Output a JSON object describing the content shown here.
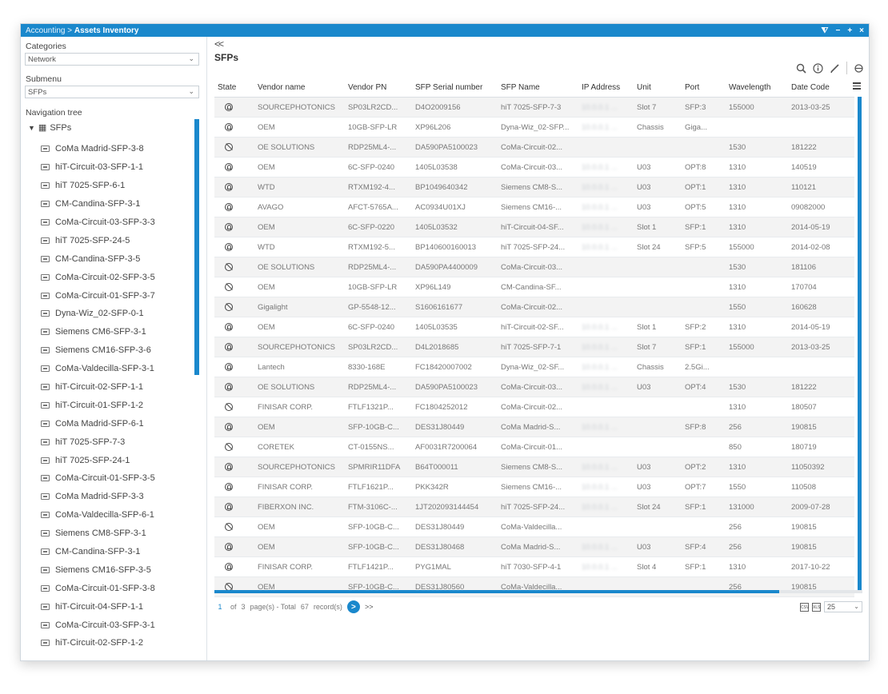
{
  "window": {
    "breadcrumb_parent": "Accounting >",
    "breadcrumb_current": "Assets Inventory",
    "controls": [
      "⧨",
      "−",
      "+",
      "×"
    ]
  },
  "sidebar": {
    "categories_label": "Categories",
    "categories_value": "Network",
    "submenu_label": "Submenu",
    "submenu_value": "SFPs",
    "nav_tree_label": "Navigation tree",
    "tree_root": "SFPs",
    "tree_items": [
      "CoMa Madrid-SFP-3-8",
      "hiT-Circuit-03-SFP-1-1",
      "hiT 7025-SFP-6-1",
      "CM-Candina-SFP-3-1",
      "CoMa-Circuit-03-SFP-3-3",
      "hiT 7025-SFP-24-5",
      "CM-Candina-SFP-3-5",
      "CoMa-Circuit-02-SFP-3-5",
      "CoMa-Circuit-01-SFP-3-7",
      "Dyna-Wiz_02-SFP-0-1",
      "Siemens CM6-SFP-3-1",
      "Siemens CM16-SFP-3-6",
      "CoMa-Valdecilla-SFP-3-1",
      "hiT-Circuit-02-SFP-1-1",
      "hiT-Circuit-01-SFP-1-2",
      "CoMa Madrid-SFP-6-1",
      "hiT 7025-SFP-7-3",
      "hiT 7025-SFP-24-1",
      "CoMa-Circuit-01-SFP-3-5",
      "CoMa Madrid-SFP-3-3",
      "CoMa-Valdecilla-SFP-6-1",
      "Siemens CM8-SFP-3-1",
      "CM-Candina-SFP-3-1",
      "Siemens CM16-SFP-3-5",
      "CoMa-Circuit-01-SFP-3-8",
      "hiT-Circuit-04-SFP-1-1",
      "CoMa-Circuit-03-SFP-3-1",
      "hiT-Circuit-02-SFP-1-2"
    ]
  },
  "main": {
    "collapse": "<<",
    "title": "SFPs",
    "columns": [
      "State",
      "Vendor name",
      "Vendor PN",
      "SFP Serial number",
      "SFP Name",
      "IP Address",
      "Unit",
      "Port",
      "Wavelength",
      "Date Code"
    ],
    "rows": [
      {
        "state": "on",
        "vendor": "SOURCEPHOTONICS",
        "pn": "SP03LR2CD...",
        "serial": "D4O2009156",
        "name": "hiT 7025-SFP-7-3",
        "ip": "10.0.0.1 ...",
        "unit": "Slot 7",
        "port": "SFP:3",
        "wl": "155000",
        "date": "2013-03-25"
      },
      {
        "state": "on",
        "vendor": "OEM",
        "pn": "10GB-SFP-LR",
        "serial": "XP96L206",
        "name": "Dyna-Wiz_02-SFP...",
        "ip": "10.0.0.1 ...",
        "unit": "Chassis",
        "port": "Giga...",
        "wl": "",
        "date": ""
      },
      {
        "state": "off",
        "vendor": "OE SOLUTIONS",
        "pn": "RDP25ML4-...",
        "serial": "DA590PA5100023",
        "name": "CoMa-Circuit-02...",
        "ip": "",
        "unit": "",
        "port": "",
        "wl": "1530",
        "date": "181222"
      },
      {
        "state": "on",
        "vendor": "OEM",
        "pn": "6C-SFP-0240",
        "serial": "1405L03538",
        "name": "CoMa-Circuit-03...",
        "ip": "10.0.0.1 ...",
        "unit": "U03",
        "port": "OPT:8",
        "wl": "1310",
        "date": "140519"
      },
      {
        "state": "on",
        "vendor": "WTD",
        "pn": "RTXM192-4...",
        "serial": "BP1049640342",
        "name": "Siemens CM8-S...",
        "ip": "10.0.0.1 ...",
        "unit": "U03",
        "port": "OPT:1",
        "wl": "1310",
        "date": "110121"
      },
      {
        "state": "on",
        "vendor": "AVAGO",
        "pn": "AFCT-5765A...",
        "serial": "AC0934U01XJ",
        "name": "Siemens CM16-...",
        "ip": "10.0.0.1 ...",
        "unit": "U03",
        "port": "OPT:5",
        "wl": "1310",
        "date": "09082000"
      },
      {
        "state": "on",
        "vendor": "OEM",
        "pn": "6C-SFP-0220",
        "serial": "1405L03532",
        "name": "hiT-Circuit-04-SF...",
        "ip": "10.0.0.1 ...",
        "unit": "Slot 1",
        "port": "SFP:1",
        "wl": "1310",
        "date": "2014-05-19"
      },
      {
        "state": "on",
        "vendor": "WTD",
        "pn": "RTXM192-5...",
        "serial": "BP140600160013",
        "name": "hiT 7025-SFP-24...",
        "ip": "10.0.0.1 ...",
        "unit": "Slot 24",
        "port": "SFP:5",
        "wl": "155000",
        "date": "2014-02-08"
      },
      {
        "state": "off",
        "vendor": "OE SOLUTIONS",
        "pn": "RDP25ML4-...",
        "serial": "DA590PA4400009",
        "name": "CoMa-Circuit-03...",
        "ip": "",
        "unit": "",
        "port": "",
        "wl": "1530",
        "date": "181106"
      },
      {
        "state": "off",
        "vendor": "OEM",
        "pn": "10GB-SFP-LR",
        "serial": "XP96L149",
        "name": "CM-Candina-SF...",
        "ip": "",
        "unit": "",
        "port": "",
        "wl": "1310",
        "date": "170704"
      },
      {
        "state": "off",
        "vendor": "Gigalight",
        "pn": "GP-5548-12...",
        "serial": "S1606161677",
        "name": "CoMa-Circuit-02...",
        "ip": "",
        "unit": "",
        "port": "",
        "wl": "1550",
        "date": "160628"
      },
      {
        "state": "on",
        "vendor": "OEM",
        "pn": "6C-SFP-0240",
        "serial": "1405L03535",
        "name": "hiT-Circuit-02-SF...",
        "ip": "10.0.0.1 ...",
        "unit": "Slot 1",
        "port": "SFP:2",
        "wl": "1310",
        "date": "2014-05-19"
      },
      {
        "state": "on",
        "vendor": "SOURCEPHOTONICS",
        "pn": "SP03LR2CD...",
        "serial": "D4L2018685",
        "name": "hiT 7025-SFP-7-1",
        "ip": "10.0.0.1 ...",
        "unit": "Slot 7",
        "port": "SFP:1",
        "wl": "155000",
        "date": "2013-03-25"
      },
      {
        "state": "on",
        "vendor": "Lantech",
        "pn": "8330-168E",
        "serial": "FC18420007002",
        "name": "Dyna-Wiz_02-SF...",
        "ip": "10.0.0.1 ...",
        "unit": "Chassis",
        "port": "2.5Gi...",
        "wl": "",
        "date": ""
      },
      {
        "state": "on",
        "vendor": "OE SOLUTIONS",
        "pn": "RDP25ML4-...",
        "serial": "DA590PA5100023",
        "name": "CoMa-Circuit-03...",
        "ip": "10.0.0.1 ...",
        "unit": "U03",
        "port": "OPT:4",
        "wl": "1530",
        "date": "181222"
      },
      {
        "state": "off",
        "vendor": "FINISAR CORP.",
        "pn": "FTLF1321P...",
        "serial": "FC1804252012",
        "name": "CoMa-Circuit-02...",
        "ip": "",
        "unit": "",
        "port": "",
        "wl": "1310",
        "date": "180507"
      },
      {
        "state": "on",
        "vendor": "OEM",
        "pn": "SFP-10GB-C...",
        "serial": "DES31J80449",
        "name": "CoMa Madrid-S...",
        "ip": "10.0.0.1 ...",
        "unit": "",
        "port": "SFP:8",
        "wl": "256",
        "date": "190815"
      },
      {
        "state": "off",
        "vendor": "CORETEK",
        "pn": "CT-0155NS...",
        "serial": "AF0031R7200064",
        "name": "CoMa-Circuit-01...",
        "ip": "",
        "unit": "",
        "port": "",
        "wl": "850",
        "date": "180719"
      },
      {
        "state": "on",
        "vendor": "SOURCEPHOTONICS",
        "pn": "SPMRIR11DFA",
        "serial": "B64T000011",
        "name": "Siemens CM8-S...",
        "ip": "10.0.0.1 ...",
        "unit": "U03",
        "port": "OPT:2",
        "wl": "1310",
        "date": "11050392"
      },
      {
        "state": "on",
        "vendor": "FINISAR CORP.",
        "pn": "FTLF1621P...",
        "serial": "PKK342R",
        "name": "Siemens CM16-...",
        "ip": "10.0.0.1 ...",
        "unit": "U03",
        "port": "OPT:7",
        "wl": "1550",
        "date": "110508"
      },
      {
        "state": "on",
        "vendor": "FIBERXON INC.",
        "pn": "FTM-3106C-...",
        "serial": "1JT202093144454",
        "name": "hiT 7025-SFP-24...",
        "ip": "10.0.0.1 ...",
        "unit": "Slot 24",
        "port": "SFP:1",
        "wl": "131000",
        "date": "2009-07-28"
      },
      {
        "state": "off",
        "vendor": "OEM",
        "pn": "SFP-10GB-C...",
        "serial": "DES31J80449",
        "name": "CoMa-Valdecilla...",
        "ip": "",
        "unit": "",
        "port": "",
        "wl": "256",
        "date": "190815"
      },
      {
        "state": "on",
        "vendor": "OEM",
        "pn": "SFP-10GB-C...",
        "serial": "DES31J80468",
        "name": "CoMa Madrid-S...",
        "ip": "10.0.0.1 ...",
        "unit": "U03",
        "port": "SFP:4",
        "wl": "256",
        "date": "190815"
      },
      {
        "state": "on",
        "vendor": "FINISAR CORP.",
        "pn": "FTLF1421P...",
        "serial": "PYG1MAL",
        "name": "hiT 7030-SFP-4-1",
        "ip": "10.0.0.1 ...",
        "unit": "Slot 4",
        "port": "SFP:1",
        "wl": "1310",
        "date": "2017-10-22"
      },
      {
        "state": "off",
        "vendor": "OEM",
        "pn": "SFP-10GB-C...",
        "serial": "DES31J80560",
        "name": "CoMa-Valdecilla...",
        "ip": "",
        "unit": "",
        "port": "",
        "wl": "256",
        "date": "190815"
      }
    ]
  },
  "pager": {
    "page": "1",
    "of_text": "of",
    "pages": "3",
    "pages_text": "page(s) - Total",
    "total": "67",
    "records_text": "record(s)",
    "next": ">",
    "last": ">>",
    "page_size": "25"
  },
  "colors": {
    "accent": "#1a88cc"
  }
}
